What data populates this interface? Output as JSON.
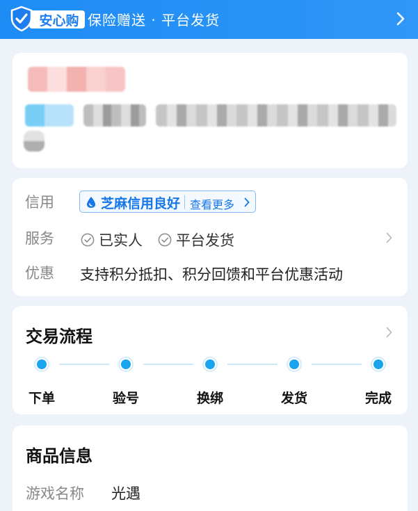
{
  "banner": {
    "badge_label": "安心购",
    "text": "保险赠送 · 平台发货",
    "icons": {
      "shield": "shield-check-icon",
      "chevron": "chevron-right-icon"
    }
  },
  "info": {
    "credit": {
      "label": "信用",
      "badge_text": "芝麻信用良好",
      "more_text": "查看更多"
    },
    "service": {
      "label": "服务",
      "items": [
        "已实人",
        "平台发货"
      ]
    },
    "promo": {
      "label": "优惠",
      "text": "支持积分抵扣、积分回馈和平台优惠活动"
    }
  },
  "process": {
    "title": "交易流程",
    "steps": [
      "下单",
      "验号",
      "换绑",
      "发货",
      "完成"
    ]
  },
  "goods": {
    "title": "商品信息",
    "rows": [
      {
        "label": "游戏名称",
        "value": "光遇"
      }
    ]
  },
  "colors": {
    "brand_blue": "#1e8cf5",
    "step_blue": "#1aa3ee",
    "link_blue": "#1677e8"
  }
}
